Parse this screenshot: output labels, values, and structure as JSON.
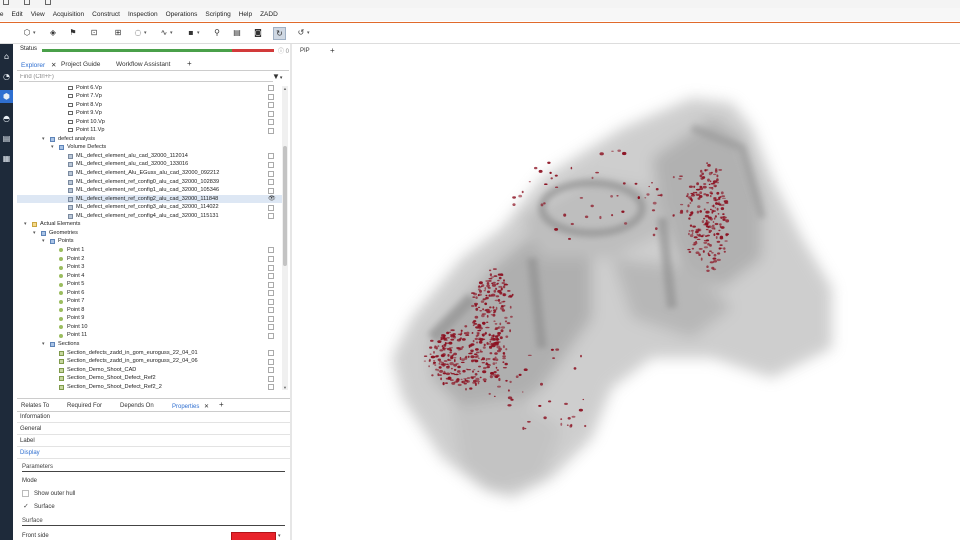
{
  "menubar": [
    "ile",
    "Edit",
    "View",
    "Acquisition",
    "Construct",
    "Inspection",
    "Operations",
    "Scripting",
    "Help",
    "ZADD"
  ],
  "status": {
    "label": "Status",
    "progress": 0.82,
    "info": "0"
  },
  "explorer_tabs": [
    {
      "label": "Explorer",
      "active": true,
      "close": "✕"
    },
    {
      "label": "Project Guide",
      "active": false
    },
    {
      "label": "Workflow Assistant",
      "active": false
    },
    {
      "label": "+",
      "active": false
    }
  ],
  "find": {
    "placeholder": "Find (Ctrl+F)"
  },
  "tree": [
    {
      "level": 5,
      "icon": "vp",
      "label": "Point 6.Vp",
      "check": true
    },
    {
      "level": 5,
      "icon": "vp",
      "label": "Point 7.Vp",
      "check": true
    },
    {
      "level": 5,
      "icon": "vp",
      "label": "Point 8.Vp",
      "check": true
    },
    {
      "level": 5,
      "icon": "vp",
      "label": "Point 9.Vp",
      "check": true
    },
    {
      "level": 5,
      "icon": "vp",
      "label": "Point 10.Vp",
      "check": true
    },
    {
      "level": 5,
      "icon": "vp",
      "label": "Point 11.Vp",
      "check": true
    },
    {
      "level": 3,
      "icon": "grp",
      "label": "defect analysis",
      "arrow": "▾"
    },
    {
      "level": 4,
      "icon": "grp",
      "label": "Volume Defects",
      "arrow": "▾"
    },
    {
      "level": 5,
      "icon": "ml",
      "label": "ML_defect_element_alu_cad_32000_112014",
      "check": true
    },
    {
      "level": 5,
      "icon": "ml",
      "label": "ML_defect_element_alu_cad_32000_133016",
      "check": true
    },
    {
      "level": 5,
      "icon": "ml",
      "label": "ML_defect_element_Alu_EGuss_alu_cad_32000_092212",
      "check": true
    },
    {
      "level": 5,
      "icon": "ml",
      "label": "ML_defect_element_ref_config0_alu_cad_32000_102839",
      "check": true
    },
    {
      "level": 5,
      "icon": "ml",
      "label": "ML_defect_element_ref_config1_alu_cad_32000_105346",
      "check": true
    },
    {
      "level": 5,
      "icon": "ml",
      "label": "ML_defect_element_ref_config2_alu_cad_32000_111848",
      "eye": true,
      "selected": true
    },
    {
      "level": 5,
      "icon": "ml",
      "label": "ML_defect_element_ref_config3_alu_cad_32000_114022",
      "check": true
    },
    {
      "level": 5,
      "icon": "ml",
      "label": "ML_defect_element_ref_config4_alu_cad_32000_115131",
      "check": true
    },
    {
      "level": 1,
      "icon": "folder",
      "label": "Actual Elements",
      "arrow": "▾"
    },
    {
      "level": 2,
      "icon": "grp",
      "label": "Geometries",
      "arrow": "▾"
    },
    {
      "level": 3,
      "icon": "grp",
      "label": "Points",
      "arrow": "▾"
    },
    {
      "level": 4,
      "icon": "pt",
      "label": "Point 1",
      "check": true
    },
    {
      "level": 4,
      "icon": "pt",
      "label": "Point 2",
      "check": true
    },
    {
      "level": 4,
      "icon": "pt",
      "label": "Point 3",
      "check": true
    },
    {
      "level": 4,
      "icon": "pt",
      "label": "Point 4",
      "check": true
    },
    {
      "level": 4,
      "icon": "pt",
      "label": "Point 5",
      "check": true
    },
    {
      "level": 4,
      "icon": "pt",
      "label": "Point 6",
      "check": true
    },
    {
      "level": 4,
      "icon": "pt",
      "label": "Point 7",
      "check": true
    },
    {
      "level": 4,
      "icon": "pt",
      "label": "Point 8",
      "check": true
    },
    {
      "level": 4,
      "icon": "pt",
      "label": "Point 9",
      "check": true
    },
    {
      "level": 4,
      "icon": "pt",
      "label": "Point 10",
      "check": true
    },
    {
      "level": 4,
      "icon": "pt",
      "label": "Point 11",
      "check": true
    },
    {
      "level": 3,
      "icon": "grp",
      "label": "Sections",
      "arrow": "▾"
    },
    {
      "level": 4,
      "icon": "sec",
      "label": "Section_defects_zadd_in_gom_euroguss_22_04_01",
      "check": true
    },
    {
      "level": 4,
      "icon": "sec",
      "label": "Section_defects_zadd_in_gom_euroguss_22_04_06",
      "check": true
    },
    {
      "level": 4,
      "icon": "sec",
      "label": "Section_Demo_Shoot_CAD",
      "check": true
    },
    {
      "level": 4,
      "icon": "sec",
      "label": "Section_Demo_Shoot_Defect_Ref2",
      "check": true
    },
    {
      "level": 4,
      "icon": "sec",
      "label": "Section_Demo_Shoot_Defect_Ref2_2",
      "check": true
    }
  ],
  "prop_tabs": [
    {
      "label": "Relates To",
      "active": false
    },
    {
      "label": "Required For",
      "active": false
    },
    {
      "label": "Depends On",
      "active": false
    },
    {
      "label": "Properties",
      "active": true,
      "close": "✕"
    },
    {
      "label": "+",
      "active": false
    }
  ],
  "properties": {
    "information": "Information",
    "general": "General",
    "label": "Label",
    "display": "Display",
    "parameters": "Parameters",
    "mode": "Mode",
    "show_outer_hull": "Show outer hull",
    "show_outer_hull_checked": false,
    "surface_option": "Surface",
    "surface_option_checked": true,
    "surface_head": "Surface",
    "front_side": "Front side",
    "front_side_color": "#e8232b"
  },
  "viewer_tabs": {
    "pip": "PIP",
    "add": "+"
  },
  "colors": {
    "accent_blue": "#2f6fd0",
    "left_strip": "#1e2a3a",
    "toolbar_line": "#e06a2b",
    "defect_red": "#8b1020",
    "part_gray": "#7a7a7a"
  },
  "icons": {
    "toolbar": [
      "cube-view-icon",
      "layers-icon",
      "flag-icon",
      "camera-alt-icon",
      "select-icon",
      "lasso-icon",
      "curve-icon",
      "note-icon",
      "zoom-icon",
      "palette-icon",
      "screenshot-icon",
      "refresh-icon",
      "rotate-icon"
    ],
    "left_strip": [
      "home-icon",
      "dashboard-icon",
      "cube-icon",
      "inspection-icon",
      "report-icon",
      "grid-icon"
    ]
  }
}
